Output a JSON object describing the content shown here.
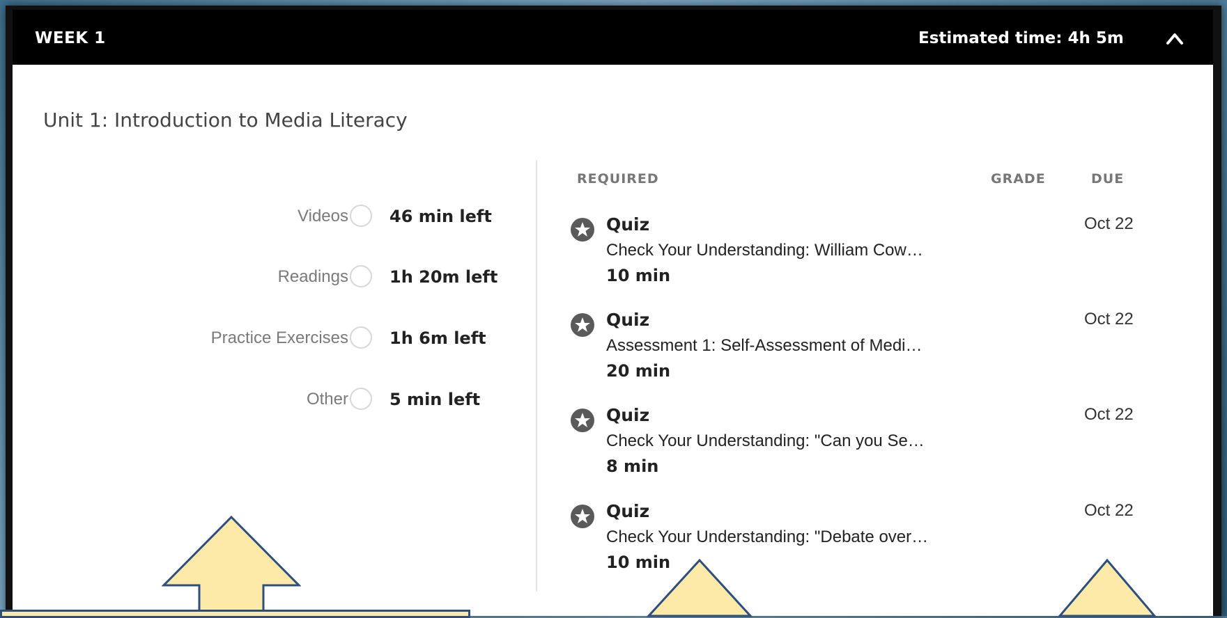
{
  "week": {
    "title": "WEEK 1",
    "estimated_time": "Estimated time: 4h 5m"
  },
  "unit": {
    "title": "Unit 1: Introduction to Media Literacy"
  },
  "progress": [
    {
      "label": "Videos",
      "value": "46 min left"
    },
    {
      "label": "Readings",
      "value": "1h 20m left"
    },
    {
      "label": "Practice Exercises",
      "value": "1h 6m left"
    },
    {
      "label": "Other",
      "value": "5 min left"
    }
  ],
  "columns": {
    "required": "REQUIRED",
    "grade": "GRADE",
    "due": "DUE"
  },
  "items": [
    {
      "type": "Quiz",
      "name": "Check Your Understanding: William Cow…",
      "duration": "10 min",
      "due": "Oct 22"
    },
    {
      "type": "Quiz",
      "name": "Assessment 1: Self-Assessment of Medi…",
      "duration": "20 min",
      "due": "Oct 22"
    },
    {
      "type": "Quiz",
      "name": "Check Your Understanding: \"Can you Se…",
      "duration": "8 min",
      "due": "Oct 22"
    },
    {
      "type": "Quiz",
      "name": "Check Your Understanding: \"Debate over…",
      "duration": "10 min",
      "due": "Oct 22"
    }
  ],
  "icons": {
    "collapse": "chevron-up-icon",
    "item": "star-icon"
  },
  "colors": {
    "header_bg": "#000000",
    "callout_fill": "#fde9a8",
    "callout_stroke": "#2e4f7e",
    "star_badge": "#5a5a5a"
  }
}
